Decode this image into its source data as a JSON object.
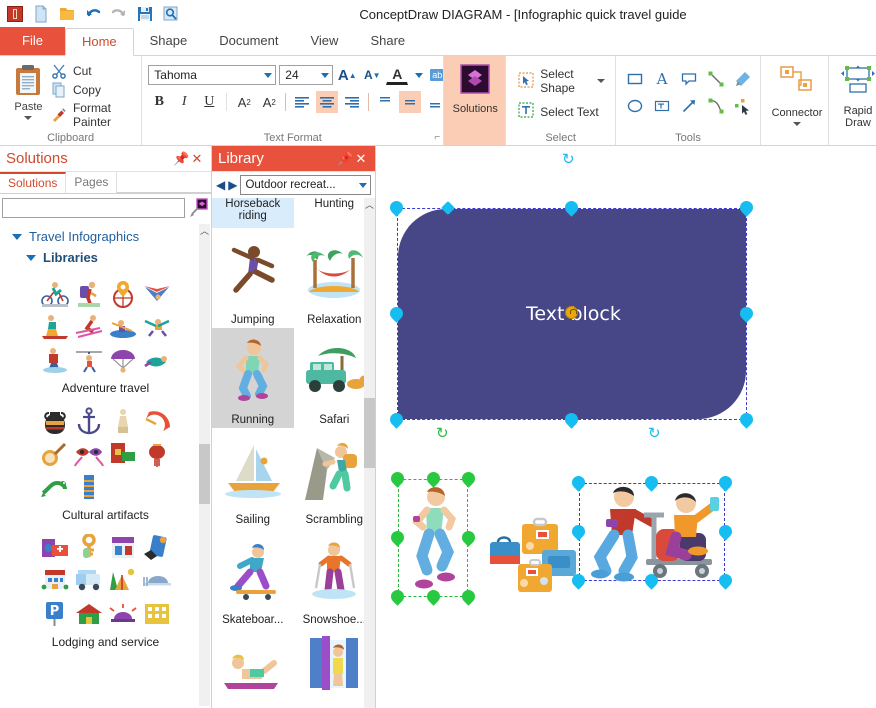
{
  "window": {
    "title": "ConceptDraw DIAGRAM - [Infographic quick travel guide"
  },
  "quick_access": [
    {
      "name": "app-icon",
      "label": "ConceptDraw"
    },
    {
      "name": "new-document-icon",
      "label": "New"
    },
    {
      "name": "open-folder-icon",
      "label": "Open"
    },
    {
      "name": "undo-icon",
      "label": "Undo"
    },
    {
      "name": "redo-icon",
      "label": "Redo"
    },
    {
      "name": "save-icon",
      "label": "Save"
    },
    {
      "name": "preview-icon",
      "label": "Preview"
    }
  ],
  "menu": {
    "file": "File",
    "tabs": [
      {
        "label": "Home",
        "active": true
      },
      {
        "label": "Shape",
        "active": false
      },
      {
        "label": "Document",
        "active": false
      },
      {
        "label": "View",
        "active": false
      },
      {
        "label": "Share",
        "active": false
      }
    ]
  },
  "ribbon": {
    "clipboard": {
      "label": "Clipboard",
      "paste": "Paste",
      "items": [
        {
          "label": "Cut",
          "icon": "scissors-icon"
        },
        {
          "label": "Copy",
          "icon": "copy-icon"
        },
        {
          "label": "Format Painter",
          "icon": "format-painter-icon"
        }
      ]
    },
    "text_format": {
      "label": "Text Format",
      "font_family": "Tahoma",
      "font_size": "24",
      "buttons_row1": [
        {
          "name": "grow-font-button",
          "glyph": "A",
          "active": false
        },
        {
          "name": "shrink-font-button",
          "glyph": "A",
          "active": false
        },
        {
          "name": "font-color-button",
          "glyph": "A",
          "active": false
        },
        {
          "name": "highlight-color-button",
          "glyph": "ab",
          "active": false
        }
      ],
      "buttons_row2": [
        {
          "name": "bold-button",
          "glyph": "B",
          "active": false
        },
        {
          "name": "italic-button",
          "glyph": "I",
          "active": false
        },
        {
          "name": "underline-button",
          "glyph": "U",
          "active": false
        },
        {
          "name": "superscript-button",
          "glyph": "A²",
          "active": false
        },
        {
          "name": "subscript-button",
          "glyph": "A₂",
          "active": false
        },
        {
          "name": "align-left-button",
          "glyph": "≡",
          "active": false
        },
        {
          "name": "align-center-button",
          "glyph": "≡",
          "active": true
        },
        {
          "name": "align-right-button",
          "glyph": "≡",
          "active": false
        },
        {
          "name": "align-top-button",
          "glyph": "=",
          "active": false
        },
        {
          "name": "align-middle-button",
          "glyph": "=",
          "active": true
        },
        {
          "name": "align-bottom-button",
          "glyph": "=",
          "active": false
        },
        {
          "name": "text-fit-button",
          "glyph": "▤",
          "active": false
        }
      ]
    },
    "solutions": {
      "label": "Solutions"
    },
    "select": {
      "label": "Select",
      "items": [
        {
          "label": "Select Shape",
          "icon": "select-shape-icon",
          "has_dropdown": true
        },
        {
          "label": "Select Text",
          "icon": "select-text-icon",
          "has_dropdown": false
        }
      ]
    },
    "tools": {
      "label": "Tools",
      "items": [
        {
          "name": "rectangle-tool-icon"
        },
        {
          "name": "text-tool-icon"
        },
        {
          "name": "callout-tool-icon"
        },
        {
          "name": "line-tool-icon"
        },
        {
          "name": "pen-tool-icon"
        },
        {
          "name": "ellipse-tool-icon"
        },
        {
          "name": "textbox-tool-icon"
        },
        {
          "name": "arrow-tool-icon"
        },
        {
          "name": "curve-tool-icon"
        },
        {
          "name": "pointer-tool-icon"
        }
      ]
    },
    "connector": {
      "label": "Connector"
    },
    "rapid_draw": {
      "label": "Rapid Draw"
    }
  },
  "solutions_panel": {
    "title": "Solutions",
    "pin": "pin-icon",
    "close": "close-icon",
    "tabs": [
      {
        "label": "Solutions",
        "active": true
      },
      {
        "label": "Pages",
        "active": false
      }
    ],
    "search": {
      "value": "",
      "placeholder": ""
    },
    "tree": [
      {
        "label": "Travel Infographics",
        "level": 1
      },
      {
        "label": "Libraries",
        "level": 2
      }
    ],
    "library_thumbnails": [
      {
        "caption": "Adventure travel"
      },
      {
        "caption": "Cultural artifacts"
      },
      {
        "caption": "Lodging and service"
      }
    ]
  },
  "library_panel": {
    "title": "Library",
    "pin": "pin-icon",
    "close": "close-icon",
    "prev": "◀",
    "next": "▶",
    "selected_library": "Outdoor recreat...",
    "items": [
      {
        "caption": "Horseback riding",
        "state": "hover"
      },
      {
        "caption": "Hunting",
        "state": "normal"
      },
      {
        "caption": "Jumping",
        "state": "normal"
      },
      {
        "caption": "Relaxation",
        "state": "normal"
      },
      {
        "caption": "Running",
        "state": "selected"
      },
      {
        "caption": "Safari",
        "state": "normal"
      },
      {
        "caption": "Sailing",
        "state": "normal"
      },
      {
        "caption": "Scrambling",
        "state": "normal"
      },
      {
        "caption": "Skateboar...",
        "state": "normal"
      },
      {
        "caption": "Snowshoe...",
        "state": "normal"
      },
      {
        "caption": "",
        "state": "normal"
      },
      {
        "caption": "",
        "state": "normal"
      }
    ]
  },
  "canvas": {
    "text_block": {
      "label": "Text block",
      "fill_color": "#474788",
      "text_color": "#ffffff"
    },
    "selections": [
      {
        "name": "text-block-shape",
        "handle_color": "#16bdf0"
      },
      {
        "name": "runner-image",
        "handle_color": "#26c93f"
      },
      {
        "name": "luggage-cart-image",
        "handle_color": "#16bdf0"
      }
    ]
  }
}
